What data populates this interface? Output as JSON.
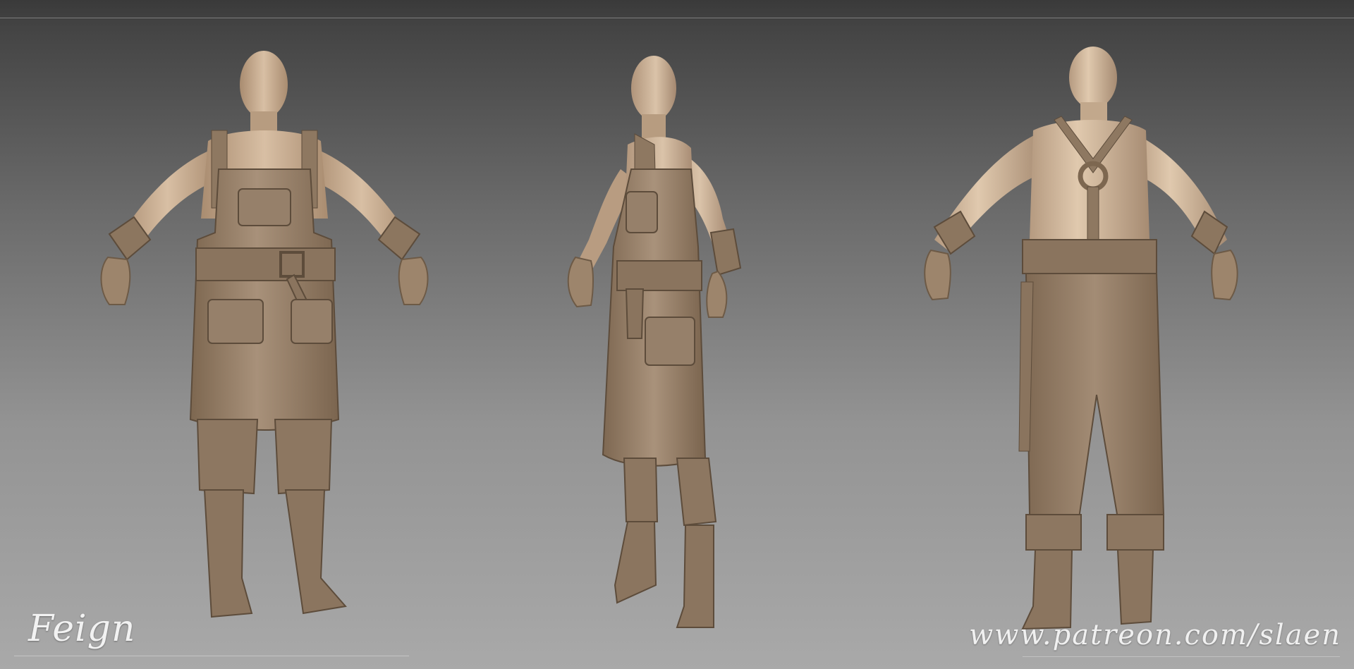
{
  "signature": "Feign",
  "url": "www.patreon.com/slaen",
  "colors": {
    "skin": "#c7ab8d",
    "leather": "#9c8469",
    "leather_dark": "#7c6750",
    "background_top": "#3a3a3a",
    "background_bottom": "#a9a9a9"
  },
  "figures": [
    "front-view",
    "side-view",
    "back-view"
  ]
}
